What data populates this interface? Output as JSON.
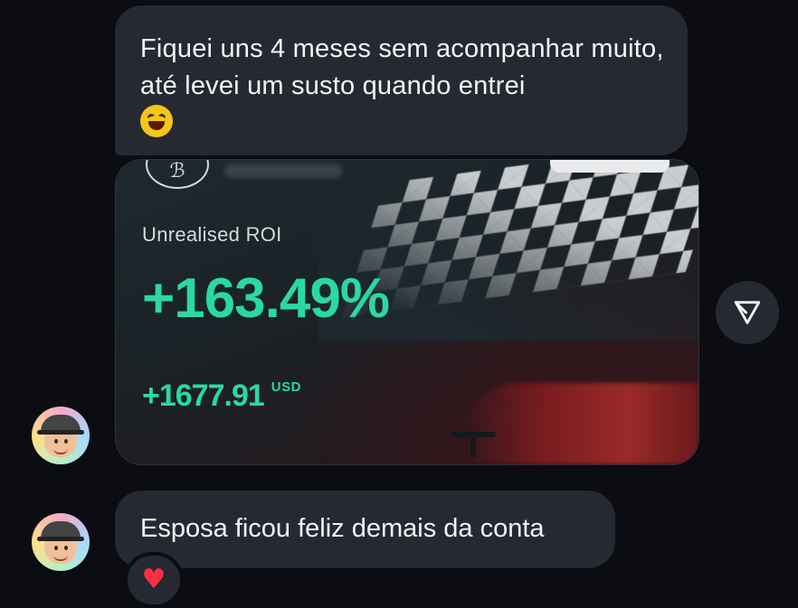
{
  "messages": [
    {
      "text": "Fiquei uns 4 meses sem acompanhar muito, até levei um susto quando entrei",
      "emoji": "rolling-on-floor-laughing"
    },
    {
      "type": "image-card",
      "card": {
        "roi_label": "Unrealised ROI",
        "roi_value": "+163.49%",
        "usd_value": "+1677.91",
        "usd_unit": "USD",
        "accent_color": "#2ad9a1"
      }
    },
    {
      "text": "Esposa ficou feliz demais da conta",
      "reaction": "❤️"
    }
  ],
  "colors": {
    "background": "#0b0d12",
    "bubble": "#262931",
    "text": "#f3f4f6"
  },
  "icons": [
    "share-icon",
    "avatar",
    "heart-icon",
    "laughing-emoji-icon"
  ]
}
